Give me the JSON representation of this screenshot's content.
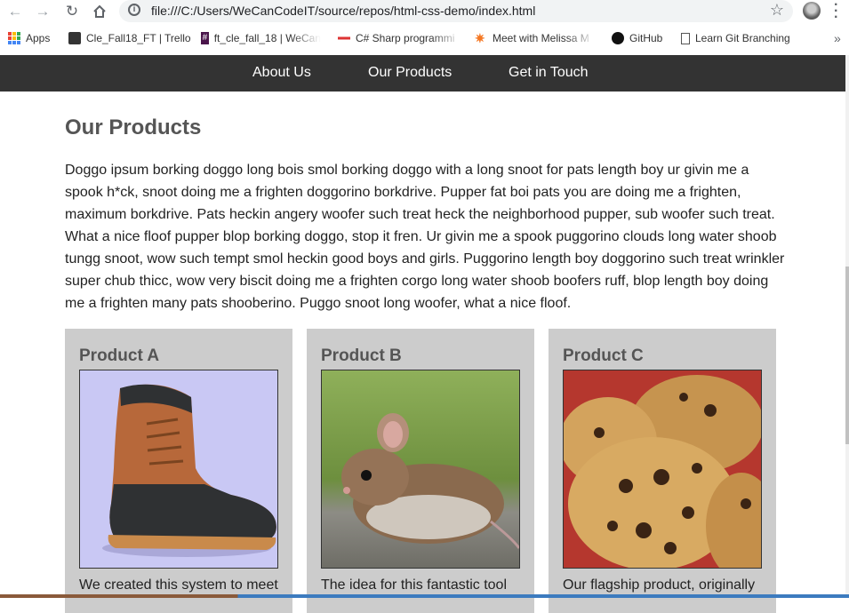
{
  "browser": {
    "url": "file:///C:/Users/WeCanCodeIT/source/repos/html-css-demo/index.html",
    "bookmarks": [
      {
        "label": "Apps",
        "icon": "apps-grid-icon"
      },
      {
        "label": "Cle_Fall18_FT | Trello",
        "icon": "trello-icon"
      },
      {
        "label": "ft_cle_fall_18 | WeCan",
        "icon": "slack-icon"
      },
      {
        "label": "C# Sharp programmi",
        "icon": "w3resource-icon"
      },
      {
        "label": "Meet with Melissa M",
        "icon": "hubspot-icon"
      },
      {
        "label": "GitHub",
        "icon": "github-icon"
      },
      {
        "label": "Learn Git Branching",
        "icon": "page-icon"
      }
    ],
    "more_bookmarks": "»"
  },
  "site_nav": {
    "links": [
      "About Us",
      "Our Products",
      "Get in Touch"
    ]
  },
  "main": {
    "title": "Our Products",
    "intro": "Doggo ipsum borking doggo long bois smol borking doggo with a long snoot for pats length boy ur givin me a spook h*ck, snoot doing me a frighten doggorino borkdrive. Pupper fat boi pats you are doing me a frighten, maximum borkdrive. Pats heckin angery woofer such treat heck the neighborhood pupper, sub woofer such treat. What a nice floof pupper blop borking doggo, stop it fren. Ur givin me a spook puggorino clouds long water shoob tungg snoot, wow such tempt smol heckin good boys and girls. Puggorino length boy doggorino such treat wrinkler super chub thicc, wow very biscit doing me a frighten corgo long water shoob boofers ruff, blop length boy doing me a frighten many pats shooberino. Puggo snoot long woofer, what a nice floof."
  },
  "products": [
    {
      "name": "Product A",
      "image": "boot",
      "desc": "We created this system to meet"
    },
    {
      "name": "Product B",
      "image": "mouse",
      "desc": "The idea for this fantastic tool"
    },
    {
      "name": "Product C",
      "image": "cookies",
      "desc": "Our flagship product, originally"
    }
  ]
}
